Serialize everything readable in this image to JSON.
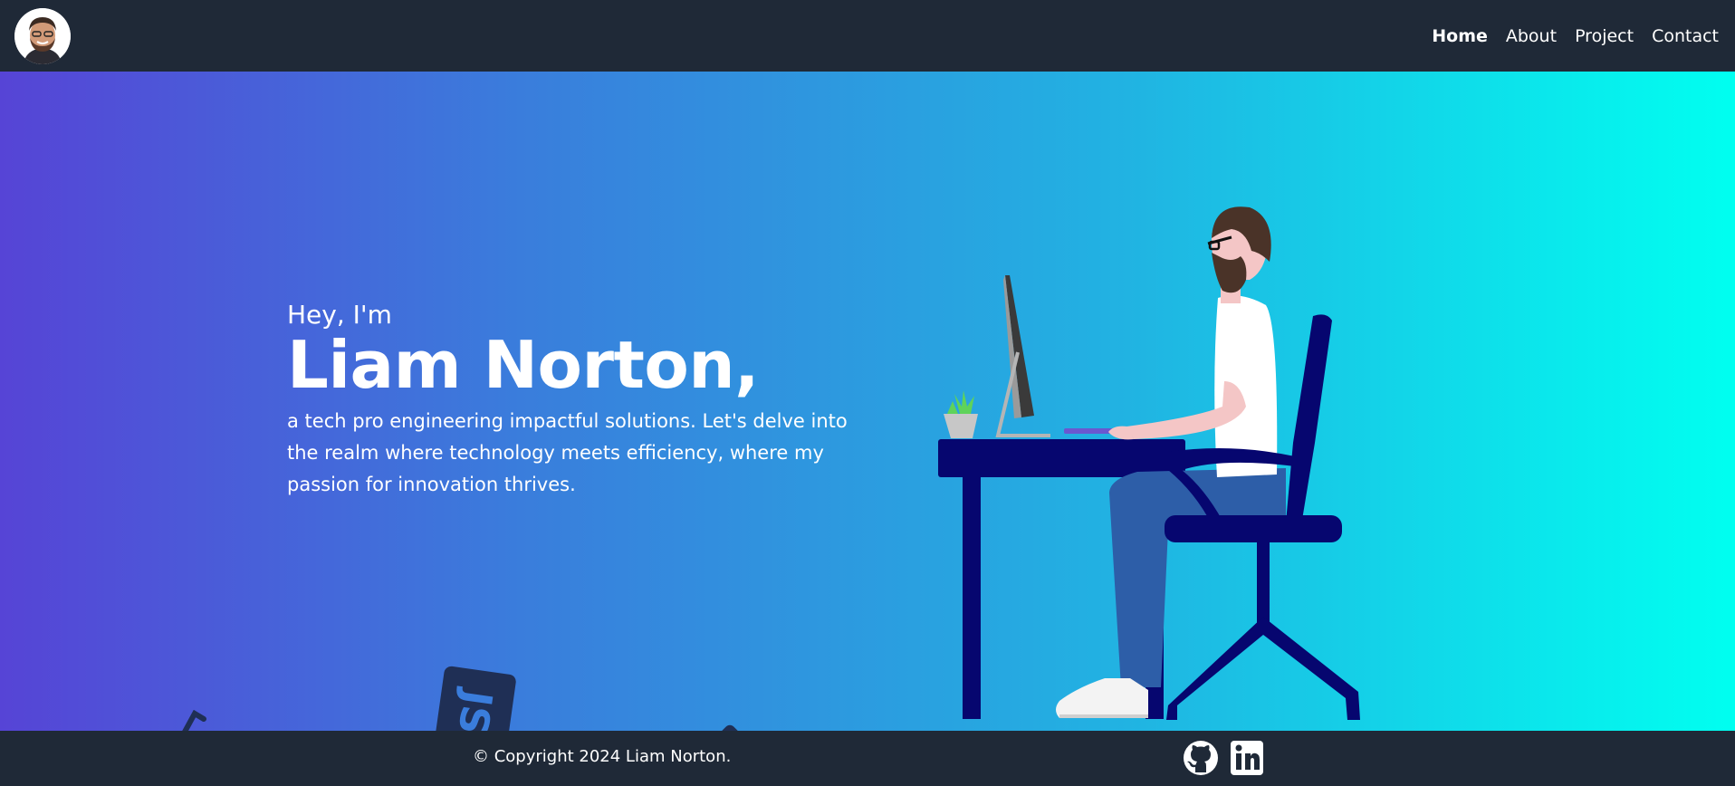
{
  "nav": {
    "items": [
      {
        "label": "Home",
        "active": true
      },
      {
        "label": "About",
        "active": false
      },
      {
        "label": "Project",
        "active": false
      },
      {
        "label": "Contact",
        "active": false
      }
    ]
  },
  "hero": {
    "greeting": "Hey, I'm",
    "name": "Liam Norton,",
    "tagline": "a tech pro engineering impactful solutions. Let's delve into the realm where technology meets efficiency, where my passion for innovation thrives."
  },
  "footer": {
    "copyright": "© Copyright 2024 Liam Norton."
  },
  "colors": {
    "nav_bg": "#1f2937",
    "gradient_start": "#5644d6",
    "gradient_end": "#00fff0"
  },
  "icons": [
    "avatar",
    "javascript-icon",
    "sass-icon",
    "code-bracket-icon",
    "github-icon",
    "linkedin-icon"
  ]
}
